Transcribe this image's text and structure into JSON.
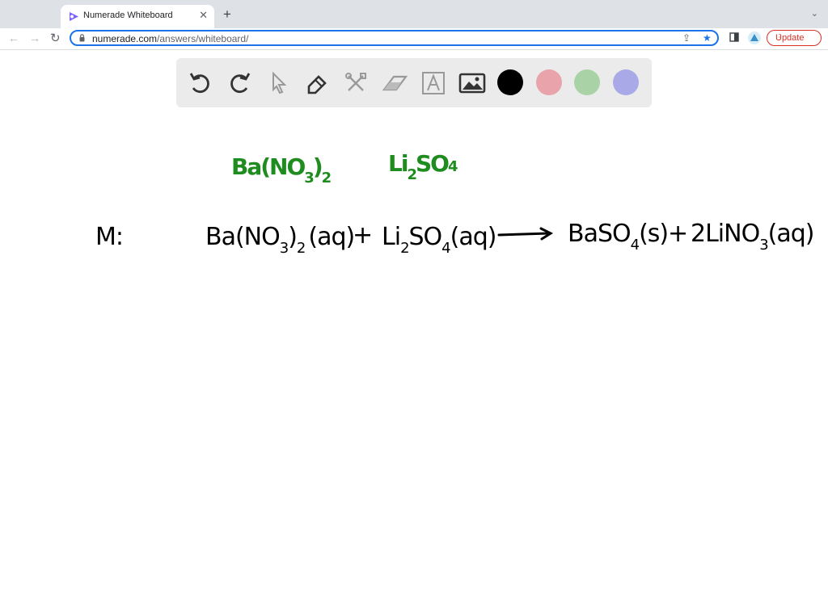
{
  "browser": {
    "tab_title": "Numerade Whiteboard",
    "tab_close": "✕",
    "new_tab": "+",
    "tab_menu": "⌄",
    "url_host": "numerade.com",
    "url_path": "/answers/whiteboard/",
    "update_label": "Update",
    "update_menu": "⋮",
    "accent_color": "#1a73e8",
    "update_color": "#d93025"
  },
  "whiteboard_toolbar": {
    "tools": [
      "undo-icon",
      "redo-icon",
      "pointer-icon",
      "pen-icon",
      "tools-icon",
      "eraser-icon",
      "text-icon",
      "image-icon"
    ],
    "swatches": [
      "#000000",
      "#e8a4aa",
      "#a9d3a6",
      "#aaa9e8"
    ]
  },
  "canvas": {
    "green_label_1": {
      "main": "Ba(NO",
      "sub1": "3",
      "mid": ")",
      "sub2": "2"
    },
    "green_label_2": {
      "main": "Li",
      "sub1": "2",
      "tail": "SO",
      "sub2": "4"
    },
    "prefix": "M:",
    "eq": {
      "r1": "Ba(NO",
      "r1_sub": "3",
      "r1_close": ")",
      "r1_sub2": "2",
      "r1_state": "(aq)",
      "plus1": "+",
      "r2a": "Li",
      "r2_sub": "2",
      "r2b": "SO",
      "r2_sub2": "4",
      "r2_state": "(aq)",
      "p1a": "BaSO",
      "p1_sub": "4",
      "p1_state": "(s)",
      "plus2": "+",
      "p2a": "2LiNO",
      "p2_sub": "3",
      "p2_state": "(aq)"
    },
    "green_color": "#1e8c1e"
  }
}
